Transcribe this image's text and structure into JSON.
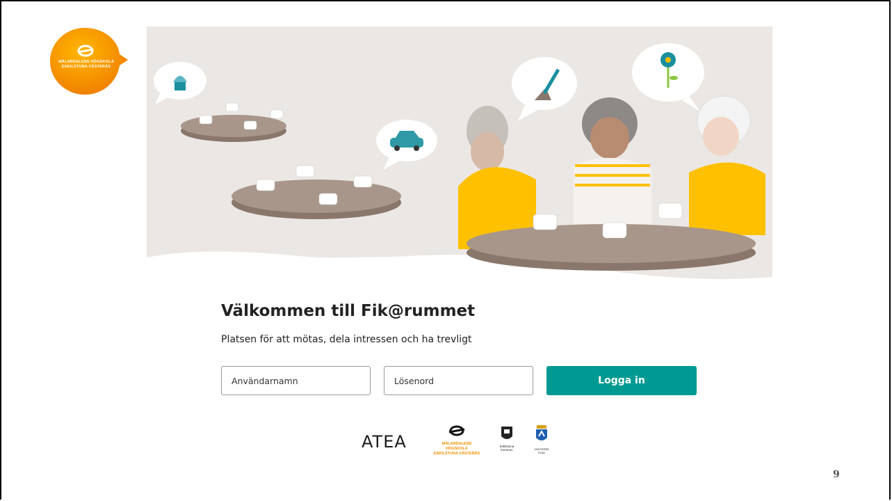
{
  "logo": {
    "name_line1": "MÄLARDALENS HÖGSKOLA",
    "name_line2": "ESKILSTUNA VÄSTERÅS",
    "color": "#f29100"
  },
  "welcome": {
    "title": "Välkommen till Fik@rummet",
    "subtitle": "Platsen för att mötas, dela intressen och ha trevligt"
  },
  "login": {
    "username_placeholder": "Användarnamn",
    "password_placeholder": "Lösenord",
    "button_label": "Logga in",
    "button_color": "#009a93"
  },
  "partners": {
    "atea": "ATEA",
    "mdh_line1": "MÄLARDALENS HÖGSKOLA",
    "mdh_line2": "ESKILSTUNA VÄSTERÅS",
    "eskilstuna_line1": "Eskilstuna",
    "eskilstuna_line2": "kommun",
    "vasteras": "VÄSTERÅS STAD"
  },
  "slide": {
    "page_number": "9"
  },
  "icons": [
    "cupcake-icon",
    "car-icon",
    "trowel-icon",
    "flower-icon",
    "teacup-icon"
  ]
}
